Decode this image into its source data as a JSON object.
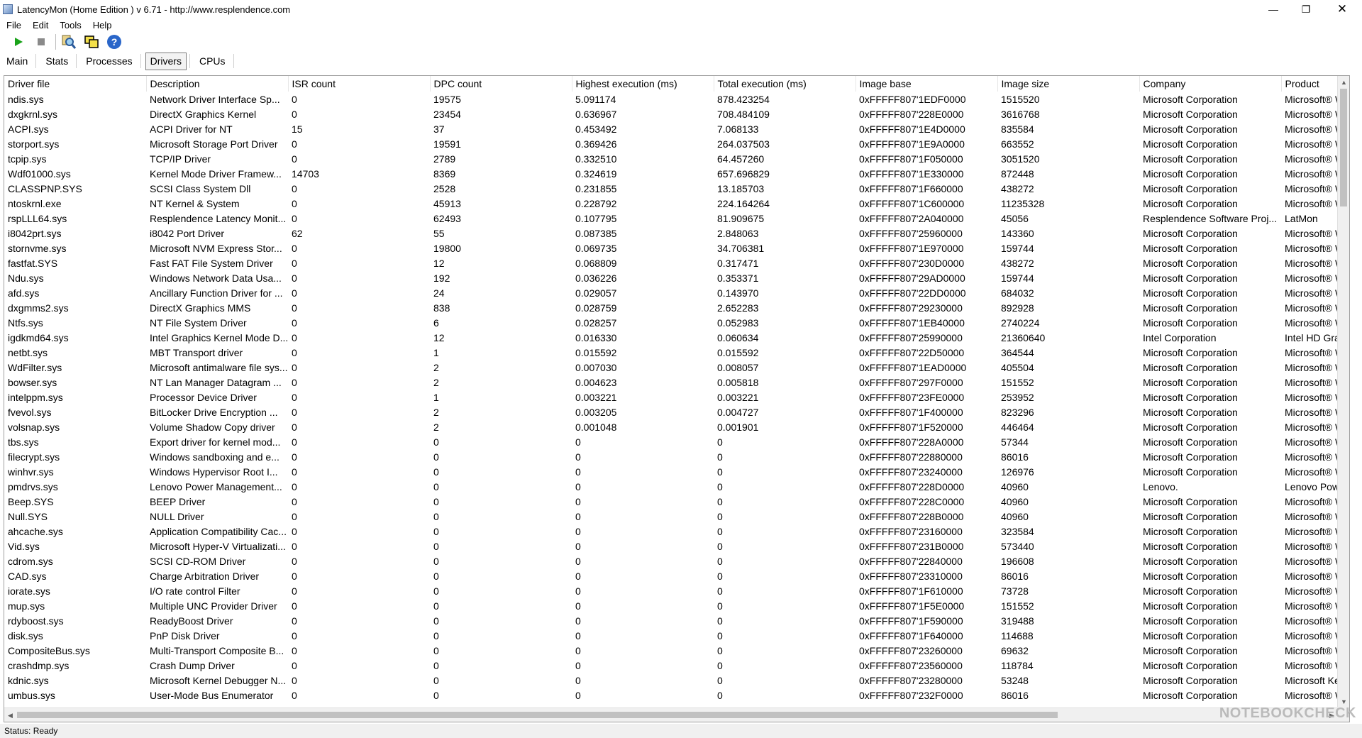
{
  "window": {
    "title": "LatencyMon  (Home Edition )  v 6.71 - http://www.resplendence.com",
    "minimize": "—",
    "maximize": "❐",
    "close": "✕"
  },
  "menu": [
    {
      "label": "File"
    },
    {
      "label": "Edit"
    },
    {
      "label": "Tools"
    },
    {
      "label": "Help"
    }
  ],
  "toolbar": {
    "icons": [
      "play-icon",
      "stop-icon",
      "search-icon",
      "windows-icon",
      "help-icon"
    ]
  },
  "tabs": [
    {
      "label": "Main",
      "active": false
    },
    {
      "label": "Stats",
      "active": false
    },
    {
      "label": "Processes",
      "active": false
    },
    {
      "label": "Drivers",
      "active": true
    },
    {
      "label": "CPUs",
      "active": false
    }
  ],
  "columns": [
    "Driver file",
    "Description",
    "ISR count",
    "DPC count",
    "Highest execution (ms)",
    "Total execution (ms)",
    "Image base",
    "Image size",
    "Company",
    "Product"
  ],
  "rows": [
    [
      "ndis.sys",
      "Network Driver Interface Sp...",
      "0",
      "19575",
      "5.091174",
      "878.423254",
      "0xFFFFF807'1EDF0000",
      "1515520",
      "Microsoft Corporation",
      "Microsoft® W"
    ],
    [
      "dxgkrnl.sys",
      "DirectX Graphics Kernel",
      "0",
      "23454",
      "0.636967",
      "708.484109",
      "0xFFFFF807'228E0000",
      "3616768",
      "Microsoft Corporation",
      "Microsoft® W"
    ],
    [
      "ACPI.sys",
      "ACPI Driver for NT",
      "15",
      "37",
      "0.453492",
      "7.068133",
      "0xFFFFF807'1E4D0000",
      "835584",
      "Microsoft Corporation",
      "Microsoft® W"
    ],
    [
      "storport.sys",
      "Microsoft Storage Port Driver",
      "0",
      "19591",
      "0.369426",
      "264.037503",
      "0xFFFFF807'1E9A0000",
      "663552",
      "Microsoft Corporation",
      "Microsoft® W"
    ],
    [
      "tcpip.sys",
      "TCP/IP Driver",
      "0",
      "2789",
      "0.332510",
      "64.457260",
      "0xFFFFF807'1F050000",
      "3051520",
      "Microsoft Corporation",
      "Microsoft® W"
    ],
    [
      "Wdf01000.sys",
      "Kernel Mode Driver Framew...",
      "14703",
      "8369",
      "0.324619",
      "657.696829",
      "0xFFFFF807'1E330000",
      "872448",
      "Microsoft Corporation",
      "Microsoft® W"
    ],
    [
      "CLASSPNP.SYS",
      "SCSI Class System Dll",
      "0",
      "2528",
      "0.231855",
      "13.185703",
      "0xFFFFF807'1F660000",
      "438272",
      "Microsoft Corporation",
      "Microsoft® W"
    ],
    [
      "ntoskrnl.exe",
      "NT Kernel & System",
      "0",
      "45913",
      "0.228792",
      "224.164264",
      "0xFFFFF807'1C600000",
      "11235328",
      "Microsoft Corporation",
      "Microsoft® W"
    ],
    [
      "rspLLL64.sys",
      "Resplendence Latency Monit...",
      "0",
      "62493",
      "0.107795",
      "81.909675",
      "0xFFFFF807'2A040000",
      "45056",
      "Resplendence Software Proj...",
      "LatMon"
    ],
    [
      "i8042prt.sys",
      "i8042 Port Driver",
      "62",
      "55",
      "0.087385",
      "2.848063",
      "0xFFFFF807'25960000",
      "143360",
      "Microsoft Corporation",
      "Microsoft® W"
    ],
    [
      "stornvme.sys",
      "Microsoft NVM Express Stor...",
      "0",
      "19800",
      "0.069735",
      "34.706381",
      "0xFFFFF807'1E970000",
      "159744",
      "Microsoft Corporation",
      "Microsoft® W"
    ],
    [
      "fastfat.SYS",
      "Fast FAT File System Driver",
      "0",
      "12",
      "0.068809",
      "0.317471",
      "0xFFFFF807'230D0000",
      "438272",
      "Microsoft Corporation",
      "Microsoft® W"
    ],
    [
      "Ndu.sys",
      "Windows Network Data Usa...",
      "0",
      "192",
      "0.036226",
      "0.353371",
      "0xFFFFF807'29AD0000",
      "159744",
      "Microsoft Corporation",
      "Microsoft® W"
    ],
    [
      "afd.sys",
      "Ancillary Function Driver for ...",
      "0",
      "24",
      "0.029057",
      "0.143970",
      "0xFFFFF807'22DD0000",
      "684032",
      "Microsoft Corporation",
      "Microsoft® W"
    ],
    [
      "dxgmms2.sys",
      "DirectX Graphics MMS",
      "0",
      "838",
      "0.028759",
      "2.652283",
      "0xFFFFF807'29230000",
      "892928",
      "Microsoft Corporation",
      "Microsoft® W"
    ],
    [
      "Ntfs.sys",
      "NT File System Driver",
      "0",
      "6",
      "0.028257",
      "0.052983",
      "0xFFFFF807'1EB40000",
      "2740224",
      "Microsoft Corporation",
      "Microsoft® W"
    ],
    [
      "igdkmd64.sys",
      "Intel Graphics Kernel Mode D...",
      "0",
      "12",
      "0.016330",
      "0.060634",
      "0xFFFFF807'25990000",
      "21360640",
      "Intel Corporation",
      "Intel HD Grapl"
    ],
    [
      "netbt.sys",
      "MBT Transport driver",
      "0",
      "1",
      "0.015592",
      "0.015592",
      "0xFFFFF807'22D50000",
      "364544",
      "Microsoft Corporation",
      "Microsoft® W"
    ],
    [
      "WdFilter.sys",
      "Microsoft antimalware file sys...",
      "0",
      "2",
      "0.007030",
      "0.008057",
      "0xFFFFF807'1EAD0000",
      "405504",
      "Microsoft Corporation",
      "Microsoft® W"
    ],
    [
      "bowser.sys",
      "NT Lan Manager Datagram ...",
      "0",
      "2",
      "0.004623",
      "0.005818",
      "0xFFFFF807'297F0000",
      "151552",
      "Microsoft Corporation",
      "Microsoft® W"
    ],
    [
      "intelppm.sys",
      "Processor Device Driver",
      "0",
      "1",
      "0.003221",
      "0.003221",
      "0xFFFFF807'23FE0000",
      "253952",
      "Microsoft Corporation",
      "Microsoft® W"
    ],
    [
      "fvevol.sys",
      "BitLocker Drive Encryption ...",
      "0",
      "2",
      "0.003205",
      "0.004727",
      "0xFFFFF807'1F400000",
      "823296",
      "Microsoft Corporation",
      "Microsoft® W"
    ],
    [
      "volsnap.sys",
      "Volume Shadow Copy driver",
      "0",
      "2",
      "0.001048",
      "0.001901",
      "0xFFFFF807'1F520000",
      "446464",
      "Microsoft Corporation",
      "Microsoft® W"
    ],
    [
      "tbs.sys",
      "Export driver for kernel mod...",
      "0",
      "0",
      "0",
      "0",
      "0xFFFFF807'228A0000",
      "57344",
      "Microsoft Corporation",
      "Microsoft® W"
    ],
    [
      "filecrypt.sys",
      "Windows sandboxing and e...",
      "0",
      "0",
      "0",
      "0",
      "0xFFFFF807'22880000",
      "86016",
      "Microsoft Corporation",
      "Microsoft® W"
    ],
    [
      "winhvr.sys",
      "Windows Hypervisor Root I...",
      "0",
      "0",
      "0",
      "0",
      "0xFFFFF807'23240000",
      "126976",
      "Microsoft Corporation",
      "Microsoft® W"
    ],
    [
      "pmdrvs.sys",
      "Lenovo Power Management...",
      "0",
      "0",
      "0",
      "0",
      "0xFFFFF807'228D0000",
      "40960",
      "Lenovo.",
      "Lenovo Power"
    ],
    [
      "Beep.SYS",
      "BEEP Driver",
      "0",
      "0",
      "0",
      "0",
      "0xFFFFF807'228C0000",
      "40960",
      "Microsoft Corporation",
      "Microsoft® W"
    ],
    [
      "Null.SYS",
      "NULL Driver",
      "0",
      "0",
      "0",
      "0",
      "0xFFFFF807'228B0000",
      "40960",
      "Microsoft Corporation",
      "Microsoft® W"
    ],
    [
      "ahcache.sys",
      "Application Compatibility Cac...",
      "0",
      "0",
      "0",
      "0",
      "0xFFFFF807'23160000",
      "323584",
      "Microsoft Corporation",
      "Microsoft® W"
    ],
    [
      "Vid.sys",
      "Microsoft Hyper-V Virtualizati...",
      "0",
      "0",
      "0",
      "0",
      "0xFFFFF807'231B0000",
      "573440",
      "Microsoft Corporation",
      "Microsoft® W"
    ],
    [
      "cdrom.sys",
      "SCSI CD-ROM Driver",
      "0",
      "0",
      "0",
      "0",
      "0xFFFFF807'22840000",
      "196608",
      "Microsoft Corporation",
      "Microsoft® W"
    ],
    [
      "CAD.sys",
      "Charge Arbitration Driver",
      "0",
      "0",
      "0",
      "0",
      "0xFFFFF807'23310000",
      "86016",
      "Microsoft Corporation",
      "Microsoft® W"
    ],
    [
      "iorate.sys",
      "I/O rate control Filter",
      "0",
      "0",
      "0",
      "0",
      "0xFFFFF807'1F610000",
      "73728",
      "Microsoft Corporation",
      "Microsoft® W"
    ],
    [
      "mup.sys",
      "Multiple UNC Provider Driver",
      "0",
      "0",
      "0",
      "0",
      "0xFFFFF807'1F5E0000",
      "151552",
      "Microsoft Corporation",
      "Microsoft® W"
    ],
    [
      "rdyboost.sys",
      "ReadyBoost Driver",
      "0",
      "0",
      "0",
      "0",
      "0xFFFFF807'1F590000",
      "319488",
      "Microsoft Corporation",
      "Microsoft® W"
    ],
    [
      "disk.sys",
      "PnP Disk Driver",
      "0",
      "0",
      "0",
      "0",
      "0xFFFFF807'1F640000",
      "114688",
      "Microsoft Corporation",
      "Microsoft® W"
    ],
    [
      "CompositeBus.sys",
      "Multi-Transport Composite B...",
      "0",
      "0",
      "0",
      "0",
      "0xFFFFF807'23260000",
      "69632",
      "Microsoft Corporation",
      "Microsoft® W"
    ],
    [
      "crashdmp.sys",
      "Crash Dump Driver",
      "0",
      "0",
      "0",
      "0",
      "0xFFFFF807'23560000",
      "118784",
      "Microsoft Corporation",
      "Microsoft® W"
    ],
    [
      "kdnic.sys",
      "Microsoft Kernel Debugger N...",
      "0",
      "0",
      "0",
      "0",
      "0xFFFFF807'23280000",
      "53248",
      "Microsoft Corporation",
      "Microsoft Kerr"
    ],
    [
      "umbus.sys",
      "User-Mode Bus Enumerator",
      "0",
      "0",
      "0",
      "0",
      "0xFFFFF807'232F0000",
      "86016",
      "Microsoft Corporation",
      "Microsoft® W"
    ]
  ],
  "status": "Status: Ready",
  "watermark": "NOTEBOOKCHECK",
  "colors": {
    "play": "#1aa31a",
    "stop": "#8a8a8a",
    "help": "#2a66c9"
  }
}
